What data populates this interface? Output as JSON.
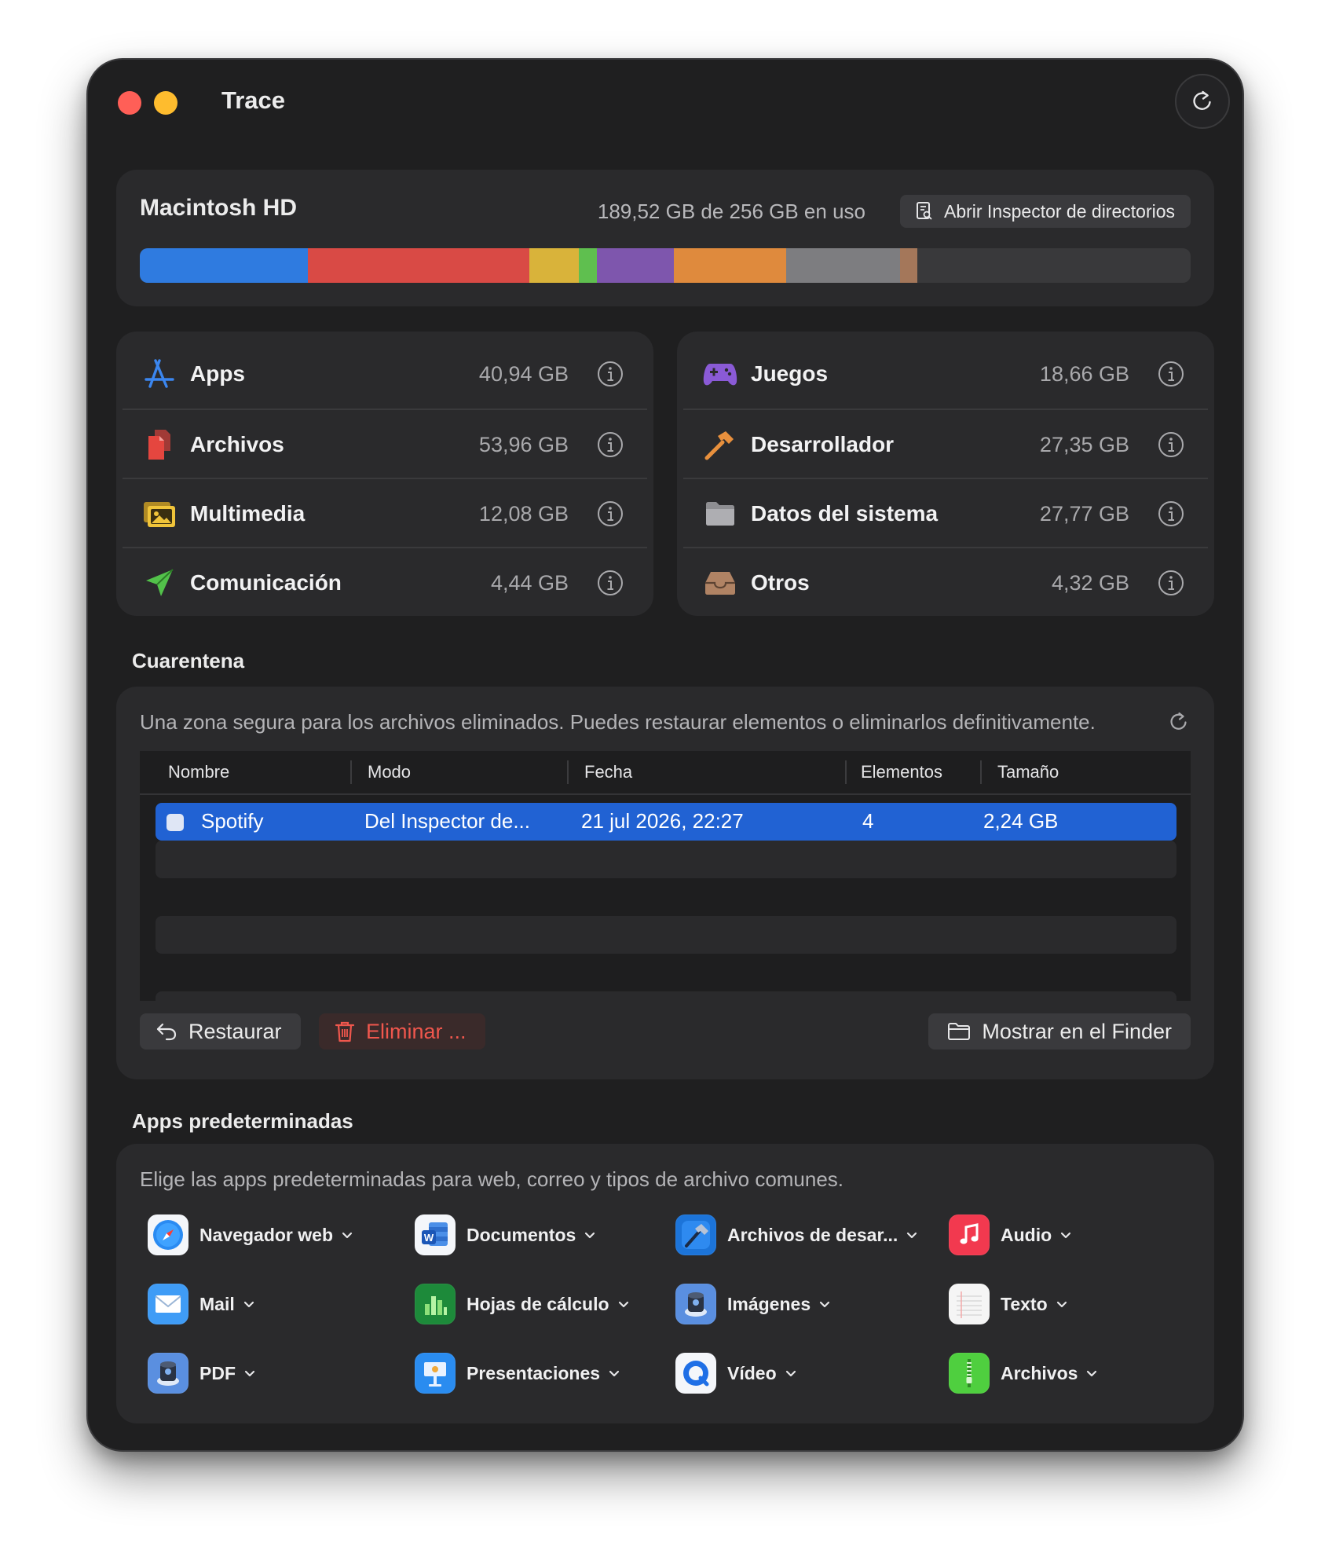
{
  "window": {
    "title": "Trace",
    "refresh_icon": "refresh-icon"
  },
  "disk": {
    "name": "Macintosh HD",
    "usage_text": "189,52 GB de 256 GB en uso",
    "inspector_button": "Abrir Inspector de directorios",
    "used_gb": 189.52,
    "total_gb": 256,
    "segments": [
      {
        "category": "Apps",
        "gb": 40.94,
        "color": "#2f7be0"
      },
      {
        "category": "Archivos",
        "gb": 53.96,
        "color": "#d94a45"
      },
      {
        "category": "Multimedia",
        "gb": 12.08,
        "color": "#d9b33a"
      },
      {
        "category": "Comunicación",
        "gb": 4.44,
        "color": "#5fbf4f"
      },
      {
        "category": "Juegos",
        "gb": 18.66,
        "color": "#7e56ad"
      },
      {
        "category": "Desarrollador",
        "gb": 27.35,
        "color": "#df8a3d"
      },
      {
        "category": "Datos del sistema",
        "gb": 27.77,
        "color": "#7d7d80"
      },
      {
        "category": "Otros",
        "gb": 4.32,
        "color": "#a4775a"
      }
    ]
  },
  "categories": {
    "left": [
      {
        "label": "Apps",
        "size": "40,94 GB",
        "icon": "app-store-icon"
      },
      {
        "label": "Archivos",
        "size": "53,96 GB",
        "icon": "documents-icon"
      },
      {
        "label": "Multimedia",
        "size": "12,08 GB",
        "icon": "photos-icon"
      },
      {
        "label": "Comunicación",
        "size": "4,44 GB",
        "icon": "paper-plane-icon"
      }
    ],
    "right": [
      {
        "label": "Juegos",
        "size": "18,66 GB",
        "icon": "gamepad-icon"
      },
      {
        "label": "Desarrollador",
        "size": "27,35 GB",
        "icon": "hammer-icon"
      },
      {
        "label": "Datos del sistema",
        "size": "27,77 GB",
        "icon": "folder-icon"
      },
      {
        "label": "Otros",
        "size": "4,32 GB",
        "icon": "tray-icon"
      }
    ]
  },
  "quarantine": {
    "title": "Cuarentena",
    "description": "Una zona segura para los archivos eliminados. Puedes restaurar elementos o eliminarlos definitivamente.",
    "columns": [
      "Nombre",
      "Modo",
      "Fecha",
      "Elementos",
      "Tamaño"
    ],
    "rows": [
      {
        "name": "Spotify",
        "mode": "Del Inspector de...",
        "date": "21 jul 2026, 22:27",
        "items": "4",
        "size": "2,24 GB"
      }
    ],
    "restore_button": "Restaurar",
    "delete_button": "Eliminar ...",
    "finder_button": "Mostrar en el Finder"
  },
  "default_apps": {
    "title": "Apps predeterminadas",
    "description": "Elige las apps predeterminadas para web, correo y tipos de archivo comunes.",
    "items": [
      {
        "label": "Navegador web",
        "icon": "safari-icon"
      },
      {
        "label": "Documentos",
        "icon": "word-icon"
      },
      {
        "label": "Archivos de desar...",
        "icon": "xcode-icon"
      },
      {
        "label": "Audio",
        "icon": "music-icon"
      },
      {
        "label": "Mail",
        "icon": "mail-icon"
      },
      {
        "label": "Hojas de cálculo",
        "icon": "numbers-icon"
      },
      {
        "label": "Imágenes",
        "icon": "preview-icon"
      },
      {
        "label": "Texto",
        "icon": "textedit-icon"
      },
      {
        "label": "PDF",
        "icon": "preview-icon"
      },
      {
        "label": "Presentaciones",
        "icon": "keynote-icon"
      },
      {
        "label": "Vídeo",
        "icon": "quicktime-icon"
      },
      {
        "label": "Archivos",
        "icon": "archive-utility-icon"
      }
    ]
  }
}
